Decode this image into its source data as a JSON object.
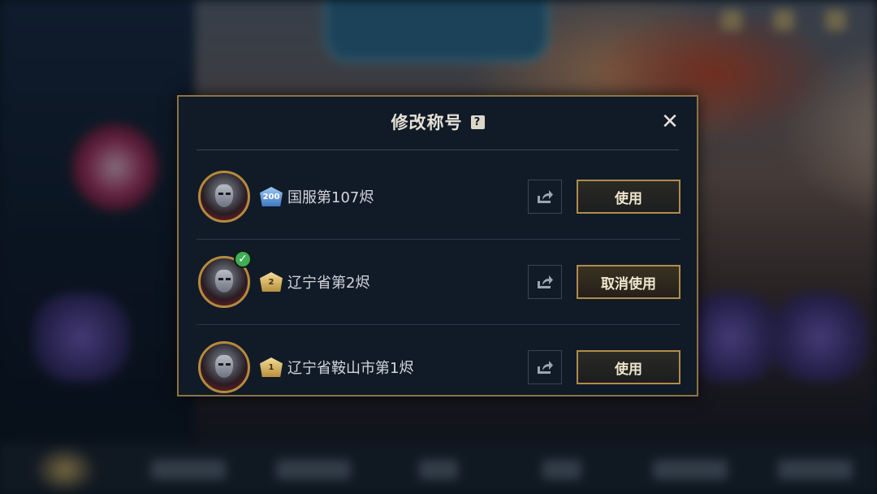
{
  "dialog": {
    "title": "修改称号",
    "help_glyph": "?",
    "close_glyph": "✕"
  },
  "titles": [
    {
      "label": "国服第107烬",
      "badge_text": "200",
      "badge_style": "blue",
      "action": "使用",
      "active": false
    },
    {
      "label": "辽宁省第2烬",
      "badge_text": "2",
      "badge_style": "gold",
      "action": "取消使用",
      "active": true
    },
    {
      "label": "辽宁省鞍山市第1烬",
      "badge_text": "1",
      "badge_style": "gold",
      "action": "使用",
      "active": false
    }
  ],
  "icons": {
    "share": "share-icon",
    "check": "✓",
    "avatar": "champion-avatar"
  },
  "colors": {
    "dialog_border": "#8c7444",
    "button_border": "#b08c4c",
    "active_check": "#3fae55"
  }
}
